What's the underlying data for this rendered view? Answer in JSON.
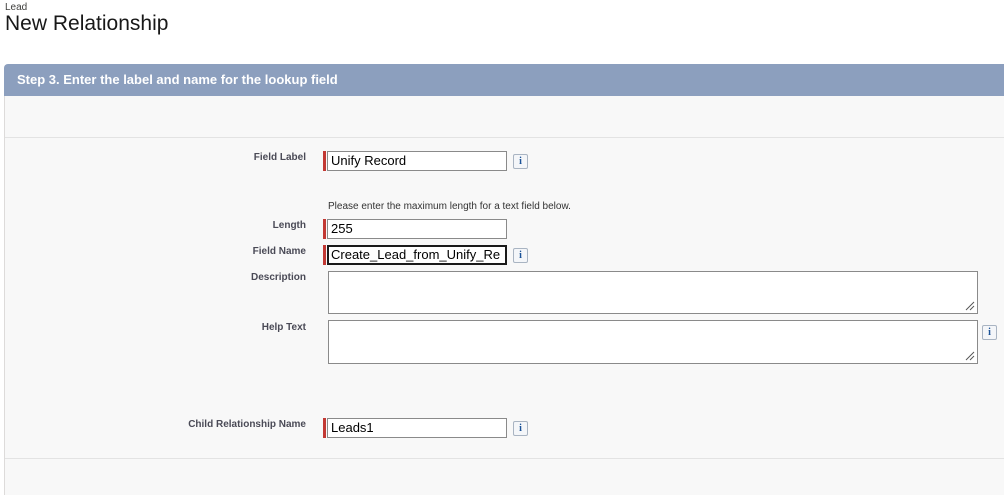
{
  "header": {
    "object_label": "Lead",
    "title": "New Relationship"
  },
  "step": {
    "title": "Step 3. Enter the label and name for the lookup field"
  },
  "form": {
    "field_label": {
      "label": "Field Label",
      "value": "Unify Record",
      "required": true
    },
    "length_hint": "Please enter the maximum length for a text field below.",
    "length": {
      "label": "Length",
      "value": "255",
      "required": true
    },
    "field_name": {
      "label": "Field Name",
      "value": "Create_Lead_from_Unify_Re",
      "required": true
    },
    "description": {
      "label": "Description",
      "value": ""
    },
    "help_text": {
      "label": "Help Text",
      "value": ""
    },
    "child_relationship_name": {
      "label": "Child Relationship Name",
      "value": "Leads1",
      "required": true
    }
  },
  "icons": {
    "info": "i",
    "info_icon_name": "info-icon",
    "resize_grip_name": "resize-grip-icon"
  },
  "colors": {
    "header_bar": "#8c9fbe",
    "required_marker": "#c23934",
    "info_text": "#1b5297"
  }
}
